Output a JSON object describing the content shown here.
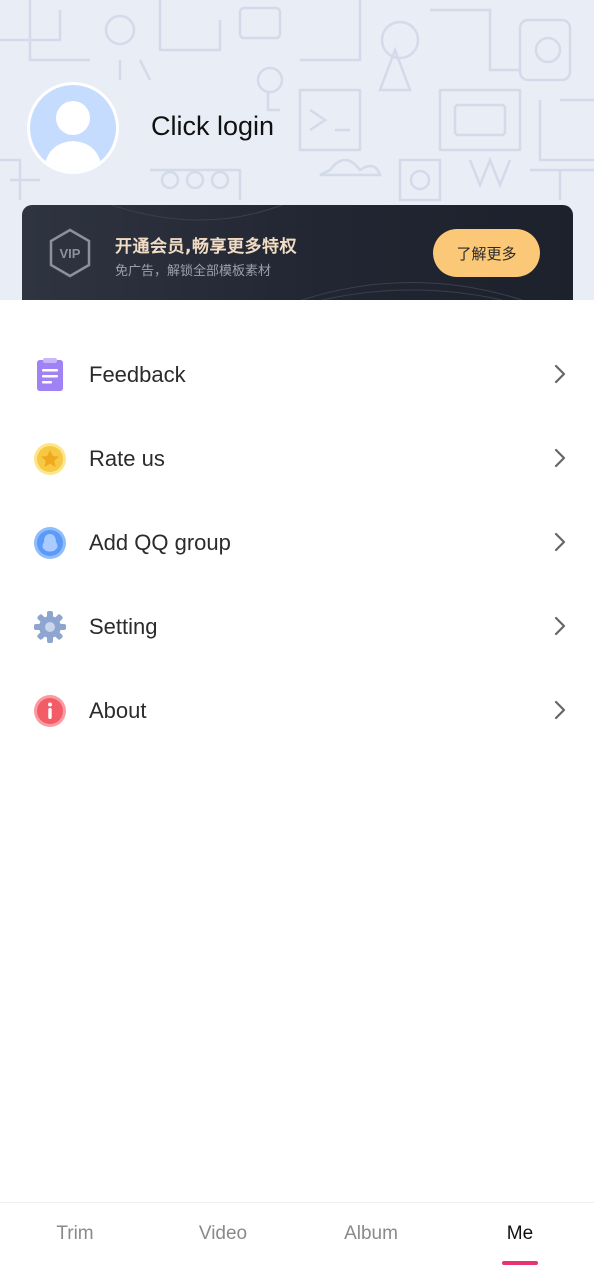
{
  "profile": {
    "login_label": "Click login"
  },
  "vip": {
    "badge_text": "VIP",
    "title": "开通会员,畅享更多特权",
    "subtitle": "免广告，解锁全部模板素材",
    "button_label": "了解更多"
  },
  "menu": {
    "items": [
      {
        "label": "Feedback",
        "icon": "clipboard-icon",
        "color": "#9a7cf2"
      },
      {
        "label": "Rate us",
        "icon": "star-icon",
        "color": "#f7c843"
      },
      {
        "label": "Add QQ group",
        "icon": "qq-penguin-icon",
        "color": "#5b9bf7"
      },
      {
        "label": "Setting",
        "icon": "gear-icon",
        "color": "#8ea6cf"
      },
      {
        "label": "About",
        "icon": "info-icon",
        "color": "#f35b66"
      }
    ]
  },
  "tabs": [
    {
      "label": "Trim",
      "active": false
    },
    {
      "label": "Video",
      "active": false
    },
    {
      "label": "Album",
      "active": false
    },
    {
      "label": "Me",
      "active": true
    }
  ],
  "colors": {
    "accent": "#e8336d",
    "vip_button": "#fac877",
    "vip_title": "#f1dcc4",
    "header_bg": "#e9edf6"
  }
}
